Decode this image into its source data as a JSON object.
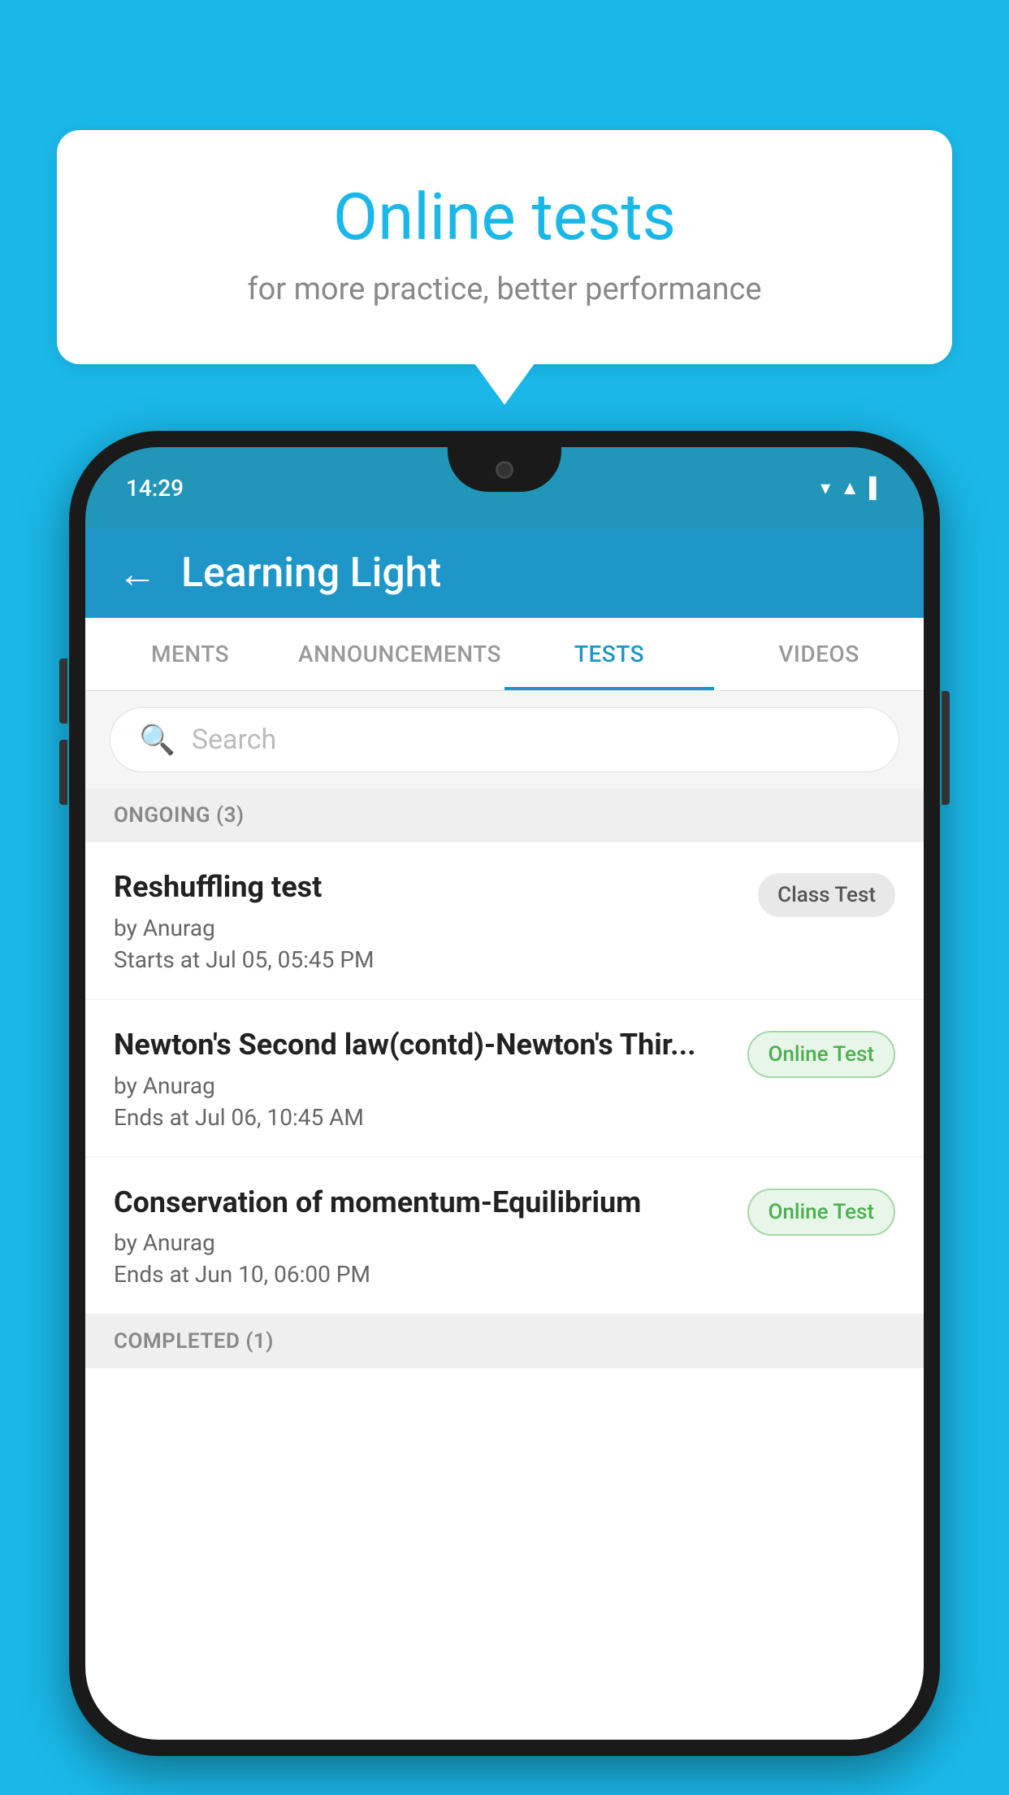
{
  "background": {
    "color": "#1ab8e8"
  },
  "speechBubble": {
    "title": "Online tests",
    "subtitle": "for more practice, better performance"
  },
  "phone": {
    "statusBar": {
      "time": "14:29",
      "icons": [
        "wifi",
        "signal",
        "battery"
      ]
    },
    "appBar": {
      "title": "Learning Light",
      "backLabel": "←"
    },
    "tabs": [
      {
        "label": "MENTS",
        "active": false
      },
      {
        "label": "ANNOUNCEMENTS",
        "active": false
      },
      {
        "label": "TESTS",
        "active": true
      },
      {
        "label": "VIDEOS",
        "active": false
      }
    ],
    "searchBar": {
      "placeholder": "Search"
    },
    "sections": [
      {
        "label": "ONGOING (3)",
        "tests": [
          {
            "name": "Reshuffling test",
            "by": "by Anurag",
            "time": "Starts at  Jul 05, 05:45 PM",
            "badgeText": "Class Test",
            "badgeType": "class"
          },
          {
            "name": "Newton's Second law(contd)-Newton's Thir...",
            "by": "by Anurag",
            "time": "Ends at  Jul 06, 10:45 AM",
            "badgeText": "Online Test",
            "badgeType": "online"
          },
          {
            "name": "Conservation of momentum-Equilibrium",
            "by": "by Anurag",
            "time": "Ends at  Jun 10, 06:00 PM",
            "badgeText": "Online Test",
            "badgeType": "online"
          }
        ]
      }
    ],
    "completedLabel": "COMPLETED (1)"
  }
}
